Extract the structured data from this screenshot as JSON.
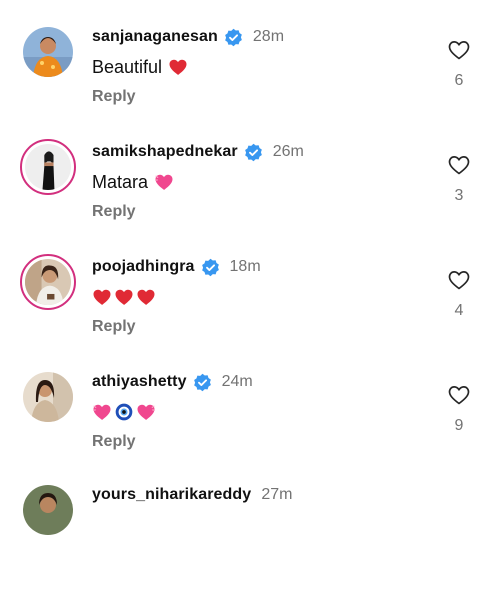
{
  "colors": {
    "verified": "#3897f0",
    "muted": "#737373",
    "story_ring": "#d22f7e",
    "heart_red": "#e02a35",
    "heart_pink": "#f0478f"
  },
  "comments": [
    {
      "username": "sanjanaganesan",
      "verified": true,
      "time": "28m",
      "text": "Beautiful",
      "emoji": [
        "red-heart"
      ],
      "reply_label": "Reply",
      "likes": "6",
      "story_ring": false
    },
    {
      "username": "samikshapednekar",
      "verified": true,
      "time": "26m",
      "text": "Matara",
      "emoji": [
        "pink-heart"
      ],
      "reply_label": "Reply",
      "likes": "3",
      "story_ring": true
    },
    {
      "username": "poojadhingra",
      "verified": true,
      "time": "18m",
      "text": "",
      "emoji": [
        "red-heart",
        "red-heart",
        "red-heart"
      ],
      "reply_label": "Reply",
      "likes": "4",
      "story_ring": true
    },
    {
      "username": "athiyashetty",
      "verified": true,
      "time": "24m",
      "text": "",
      "emoji": [
        "pink-heart",
        "nazar-amulet",
        "pink-heart"
      ],
      "reply_label": "Reply",
      "likes": "9",
      "story_ring": false
    },
    {
      "username": "yours_niharikareddy",
      "verified": false,
      "time": "27m",
      "text": "",
      "emoji": [],
      "reply_label": "",
      "likes": "",
      "story_ring": false
    }
  ]
}
